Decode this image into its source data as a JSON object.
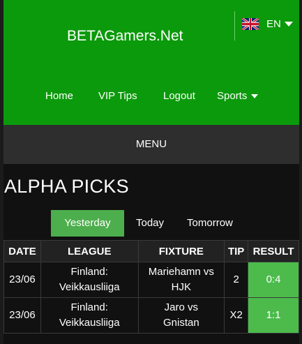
{
  "header": {
    "brand": "BETAGamers.Net",
    "language": {
      "code": "EN",
      "flag_icon": "uk-flag-icon"
    },
    "nav": [
      {
        "label": "Home"
      },
      {
        "label": "VIP Tips"
      },
      {
        "label": "Logout"
      },
      {
        "label": "Sports",
        "has_dropdown": true
      }
    ]
  },
  "menu": {
    "label": "MENU"
  },
  "page": {
    "title": "ALPHA PICKS",
    "tabs": [
      {
        "label": "Yesterday",
        "active": true
      },
      {
        "label": "Today",
        "active": false
      },
      {
        "label": "Tomorrow",
        "active": false
      }
    ]
  },
  "table": {
    "columns": [
      "DATE",
      "LEAGUE",
      "FIXTURE",
      "TIP",
      "RESULT"
    ],
    "rows": [
      {
        "date": "23/06",
        "league_country": "Finland:",
        "league_name": "Veikkausliiga",
        "fixture_home": "Mariehamn vs",
        "fixture_away": "HJK",
        "tip": "2",
        "result": "0:4"
      },
      {
        "date": "23/06",
        "league_country": "Finland:",
        "league_name": "Veikkausliiga",
        "fixture_home": "Jaro vs",
        "fixture_away": "Gnistan",
        "tip": "X2",
        "result": "1:1"
      }
    ]
  },
  "colors": {
    "header_green": "#0b9a0b",
    "active_tab": "#4cae4c",
    "result_cell": "#4cbb4c",
    "menu_bar": "#2e2e2e",
    "content_bg": "#111111"
  }
}
